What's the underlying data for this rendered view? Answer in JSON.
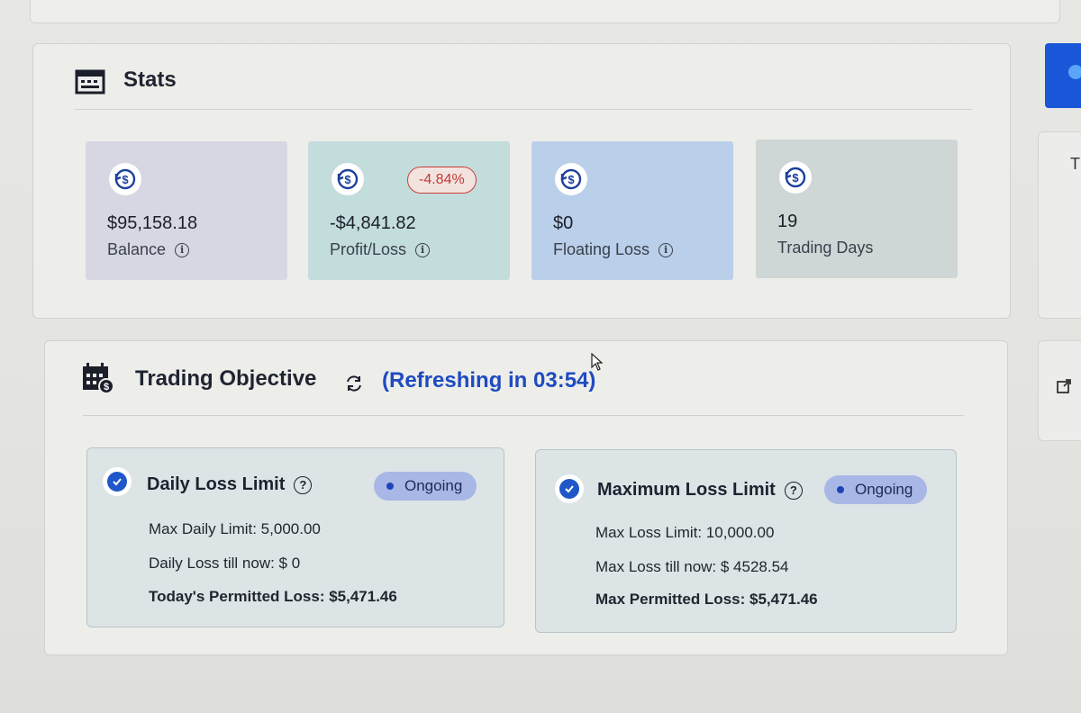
{
  "stats": {
    "title": "Stats",
    "cards": [
      {
        "value": "$95,158.18",
        "label": "Balance",
        "has_info": true,
        "bg": "#d6d7e2"
      },
      {
        "value": "-$4,841.82",
        "label": "Profit/Loss",
        "has_info": true,
        "badge": "-4.84%",
        "bg": "#c3dcdc"
      },
      {
        "value": "$0",
        "label": "Floating Loss",
        "has_info": true,
        "bg": "#bacfe9"
      },
      {
        "value": "19",
        "label": "Trading Days",
        "has_info": false,
        "bg": "#cfd7d6"
      }
    ]
  },
  "objectives": {
    "title": "Trading Objective",
    "refresh_text": "(Refreshing in 03:54)",
    "cards": [
      {
        "name": "Daily Loss Limit",
        "status": "Ongoing",
        "lines": [
          "Max Daily Limit: 5,000.00",
          "Daily Loss till now: $ 0",
          "Today's Permitted Loss: $5,471.46"
        ]
      },
      {
        "name": "Maximum Loss Limit",
        "status": "Ongoing",
        "lines": [
          "Max Loss Limit: 10,000.00",
          "Max Loss till now: $ 4528.54",
          "Max Permitted Loss: $5,471.46"
        ]
      }
    ]
  },
  "side": {
    "t_label": "T"
  },
  "colors": {
    "accent": "#1e4bbf",
    "loss_badge": "#c43a34",
    "status_pill": "#a9b7e6",
    "check": "#1f57c9"
  }
}
